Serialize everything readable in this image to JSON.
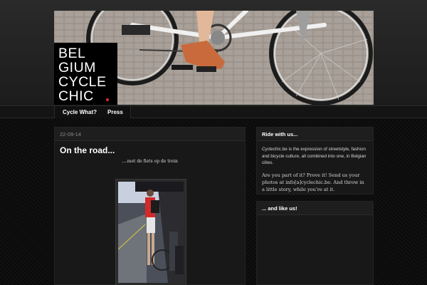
{
  "header": {
    "logo_lines": [
      "BEL",
      "GIUM",
      "CYCLE",
      "CHIC"
    ],
    "colors": {
      "logo_background": "#000000",
      "logo_dot": "#e02b2b"
    }
  },
  "nav": {
    "items": [
      {
        "label": "Cycle What?"
      },
      {
        "label": "Press"
      }
    ]
  },
  "post": {
    "date": "22-09-14",
    "title": "On the road...",
    "subtitle": "....met de fiets op de trein"
  },
  "sidebar": {
    "widgets": [
      {
        "title": "Ride with us...",
        "paragraphs": [
          "Cyclechic.be is the expression of streetstyle, fashion and bicycle culture, all combined into one, in Belgian cities.",
          "Are you part of it? Prove it! Send us your photos at info[a]cyclechic.be. And throw in a little story, while you're at it."
        ]
      },
      {
        "title": "... and like us!"
      }
    ]
  }
}
